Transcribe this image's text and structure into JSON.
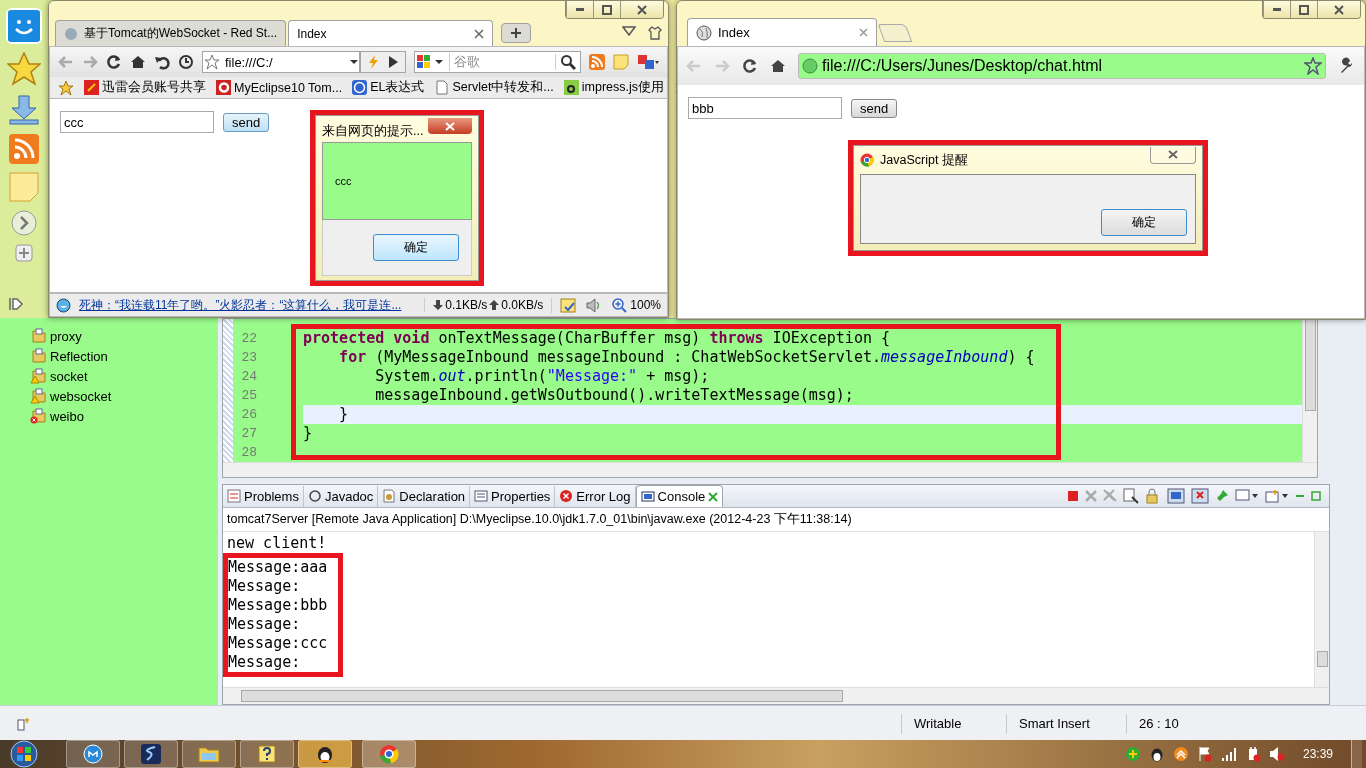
{
  "left_browser": {
    "tabs": [
      {
        "label": "基于Tomcat的WebSocket - Red St...",
        "selected": false
      },
      {
        "label": "Index",
        "selected": true
      }
    ],
    "address": "file:///C:/",
    "search_placeholder": "谷歌",
    "bookmarks": [
      "迅雷会员账号共享",
      "MyEclipse10 Tom...",
      "EL表达式",
      "Servlet中转发和...",
      "impress.js使用"
    ],
    "page": {
      "input": "ccc",
      "button": "send"
    },
    "alert": {
      "title": "来自网页的提示...",
      "message": "ccc",
      "button": "确定",
      "highlighted": true
    },
    "status": {
      "news": "死神：“我连载11年了哟。”火影忍者：“这算什么，我可是连...",
      "down": "0.1KB/s",
      "up": "0.0KB/s",
      "zoom": "100%"
    }
  },
  "right_browser": {
    "tabs": [
      {
        "label": "Index",
        "selected": true
      }
    ],
    "address": "file:///C:/Users/Junes/Desktop/chat.html",
    "page": {
      "input": "bbb",
      "button": "send"
    },
    "alert": {
      "title": "JavaScript 提醒",
      "button": "确定",
      "highlighted": true
    }
  },
  "eclipse": {
    "packages": [
      {
        "name": "proxy",
        "warning": false,
        "error": false
      },
      {
        "name": "Reflection",
        "warning": false,
        "error": false
      },
      {
        "name": "socket",
        "warning": true,
        "error": false
      },
      {
        "name": "websocket",
        "warning": true,
        "error": false
      },
      {
        "name": "weibo",
        "warning": false,
        "error": true
      }
    ],
    "editor": {
      "highlighted": true,
      "lines": [
        {
          "number": "22",
          "current": false,
          "tokens": [
            {
              "kind": "keyword",
              "text": "protected void"
            },
            {
              "kind": "plain",
              "text": " onTextMessage(CharBuffer msg) "
            },
            {
              "kind": "keyword",
              "text": "throws"
            },
            {
              "kind": "plain",
              "text": " IOException {"
            }
          ]
        },
        {
          "number": "23",
          "current": false,
          "tokens": [
            {
              "kind": "keyword",
              "text": "    for"
            },
            {
              "kind": "plain",
              "text": " (MyMessageInbound messageInbound : ChatWebSocketServlet."
            },
            {
              "kind": "static",
              "text": "messageInbound"
            },
            {
              "kind": "plain",
              "text": ") {"
            }
          ]
        },
        {
          "number": "24",
          "current": false,
          "tokens": [
            {
              "kind": "plain",
              "text": "        System."
            },
            {
              "kind": "static",
              "text": "out"
            },
            {
              "kind": "plain",
              "text": ".println("
            },
            {
              "kind": "string",
              "text": "\"Message:\""
            },
            {
              "kind": "plain",
              "text": " + msg);"
            }
          ]
        },
        {
          "number": "25",
          "current": false,
          "tokens": [
            {
              "kind": "plain",
              "text": "        messageInbound.getWsOutbound().writeTextMessage(msg);"
            }
          ]
        },
        {
          "number": "26",
          "current": true,
          "tokens": [
            {
              "kind": "plain",
              "text": "    }"
            }
          ]
        },
        {
          "number": "27",
          "current": false,
          "tokens": [
            {
              "kind": "plain",
              "text": "}"
            }
          ]
        },
        {
          "number": "28",
          "current": false
        }
      ]
    },
    "console": {
      "tabs": [
        {
          "label": "Problems",
          "selected": false
        },
        {
          "label": "Javadoc",
          "selected": false
        },
        {
          "label": "Declaration",
          "selected": false
        },
        {
          "label": "Properties",
          "selected": false
        },
        {
          "label": "Error Log",
          "selected": false
        },
        {
          "label": "Console",
          "selected": true
        }
      ],
      "process": "tomcat7Server [Remote Java Application] D:\\Myeclipse.10.0\\jdk1.7.0_01\\bin\\javaw.exe (2012-4-23 下午11:38:14)",
      "lines": [
        {
          "text": "new client!",
          "highlighted": false
        },
        {
          "text": "Message:aaa",
          "highlighted": true
        },
        {
          "text": "Message:",
          "highlighted": true
        },
        {
          "text": "Message:bbb",
          "highlighted": true
        },
        {
          "text": "Message:",
          "highlighted": true
        },
        {
          "text": "Message:ccc",
          "highlighted": true
        },
        {
          "text": "Message:",
          "highlighted": true
        }
      ]
    },
    "status_bar": [
      "Writable",
      "Smart Insert",
      "26 : 10"
    ]
  },
  "taskbar": {
    "clock": "23:39"
  }
}
